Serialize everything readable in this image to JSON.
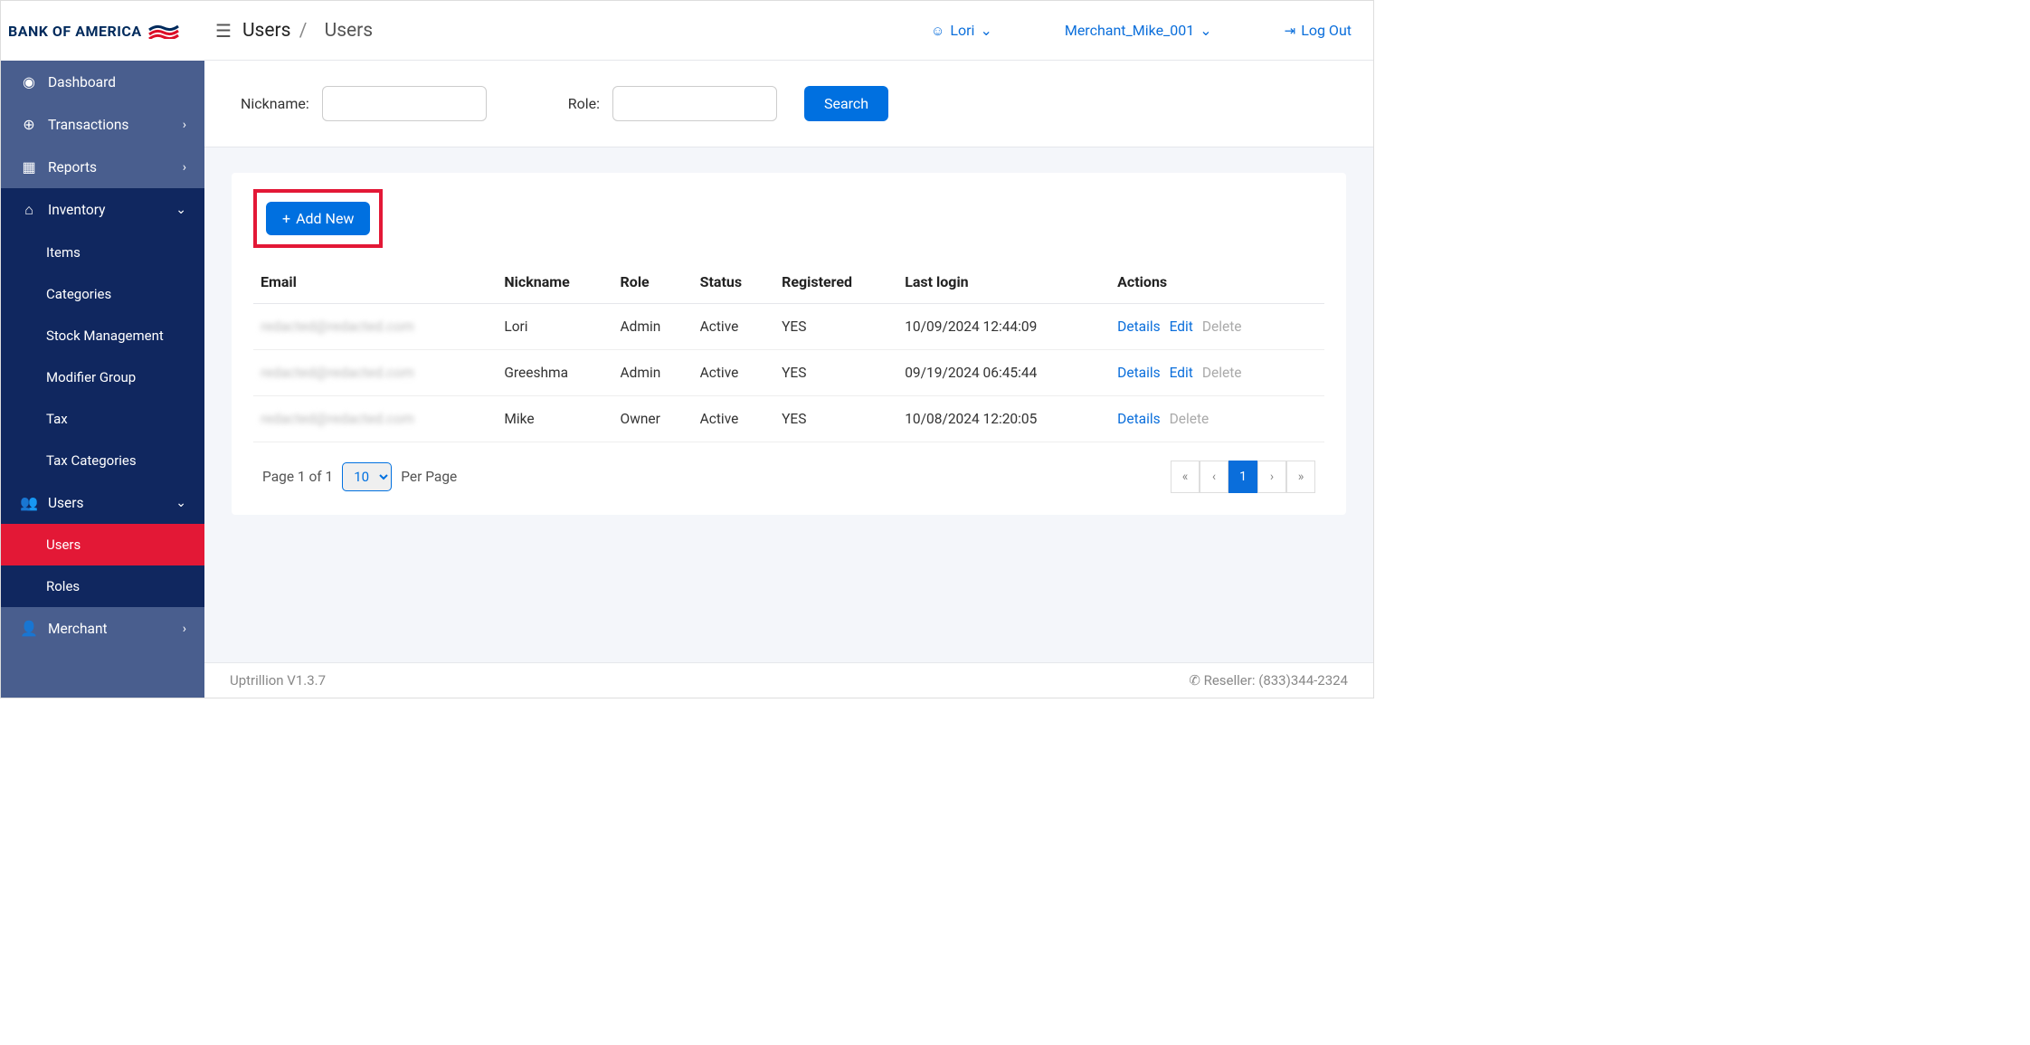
{
  "logo": {
    "text": "BANK OF AMERICA"
  },
  "sidebar": {
    "items": [
      {
        "label": "Dashboard",
        "icon": "◉"
      },
      {
        "label": "Transactions",
        "icon": "⊕",
        "chev": "›"
      },
      {
        "label": "Reports",
        "icon": "▦",
        "chev": "›"
      },
      {
        "label": "Inventory",
        "icon": "⌂",
        "chev_open": "⌄",
        "sub": [
          {
            "label": "Items"
          },
          {
            "label": "Categories"
          },
          {
            "label": "Stock Management"
          },
          {
            "label": "Modifier Group"
          },
          {
            "label": "Tax"
          },
          {
            "label": "Tax Categories"
          }
        ]
      },
      {
        "label": "Users",
        "icon": "👥",
        "chev_open": "⌄",
        "sub": [
          {
            "label": "Users",
            "active": true
          },
          {
            "label": "Roles"
          }
        ]
      },
      {
        "label": "Merchant",
        "icon": "👤",
        "chev": "›"
      }
    ]
  },
  "breadcrumb": {
    "a": "Users",
    "sep": "/",
    "b": "Users"
  },
  "topbar": {
    "user": "Lori",
    "merchant": "Merchant_Mike_001",
    "logout": "Log Out"
  },
  "filters": {
    "nickname_label": "Nickname:",
    "nickname_value": "",
    "role_label": "Role:",
    "role_value": "",
    "search_btn": "Search"
  },
  "addnew": "Add New",
  "table": {
    "columns": [
      "Email",
      "Nickname",
      "Role",
      "Status",
      "Registered",
      "Last login",
      "Actions"
    ],
    "rows": [
      {
        "email": "redacted@redacted.com",
        "nickname": "Lori",
        "role": "Admin",
        "status": "Active",
        "registered": "YES",
        "last_login": "10/09/2024  12:44:09",
        "actions": {
          "details": "Details",
          "edit": "Edit",
          "delete": "Delete"
        },
        "editable": true,
        "deletable": false
      },
      {
        "email": "redacted@redacted.com",
        "nickname": "Greeshma",
        "role": "Admin",
        "status": "Active",
        "registered": "YES",
        "last_login": "09/19/2024  06:45:44",
        "actions": {
          "details": "Details",
          "edit": "Edit",
          "delete": "Delete"
        },
        "editable": true,
        "deletable": false
      },
      {
        "email": "redacted@redacted.com",
        "nickname": "Mike",
        "role": "Owner",
        "status": "Active",
        "registered": "YES",
        "last_login": "10/08/2024  12:20:05",
        "actions": {
          "details": "Details",
          "delete": "Delete"
        },
        "editable": false,
        "deletable": false
      }
    ]
  },
  "paging": {
    "page_text": "Page 1 of 1",
    "perpage": "10",
    "perpage_label": "Per Page",
    "first": "«",
    "prev": "‹",
    "page": "1",
    "next": "›",
    "last": "»"
  },
  "footer": {
    "version": "Uptrillion V1.3.7",
    "reseller": "Reseller:  (833)344-2324"
  }
}
